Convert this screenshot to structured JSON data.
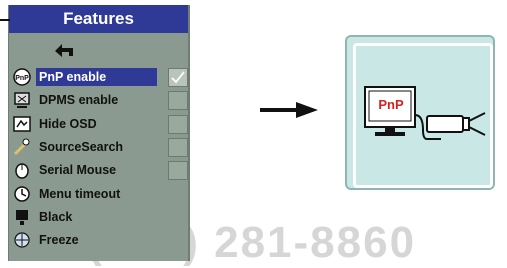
{
  "menu": {
    "title": "Features",
    "items": [
      {
        "label": "PnP enable",
        "icon": "pnp-icon",
        "selected": true,
        "checkbox": true,
        "checked": true
      },
      {
        "label": "DPMS enable",
        "icon": "dpms-icon",
        "selected": false,
        "checkbox": true,
        "checked": false
      },
      {
        "label": "Hide OSD",
        "icon": "hide-osd-icon",
        "selected": false,
        "checkbox": true,
        "checked": false
      },
      {
        "label": "SourceSearch",
        "icon": "source-search-icon",
        "selected": false,
        "checkbox": true,
        "checked": false
      },
      {
        "label": "Serial Mouse",
        "icon": "mouse-icon",
        "selected": false,
        "checkbox": true,
        "checked": false
      },
      {
        "label": "Menu timeout",
        "icon": "menu-timeout-icon",
        "selected": false,
        "checkbox": false
      },
      {
        "label": "Black",
        "icon": "black-icon",
        "selected": false,
        "checkbox": false
      },
      {
        "label": "Freeze",
        "icon": "freeze-icon",
        "selected": false,
        "checkbox": false
      }
    ]
  },
  "illustration": {
    "screen_label": "PnP"
  },
  "watermark": "00 (800) 281-8860",
  "colors": {
    "menu_title_bg": "#2e3a96",
    "menu_bg": "#8b9a90",
    "illus_bg": "#c9e7e5",
    "pnp_red": "#d42020"
  }
}
